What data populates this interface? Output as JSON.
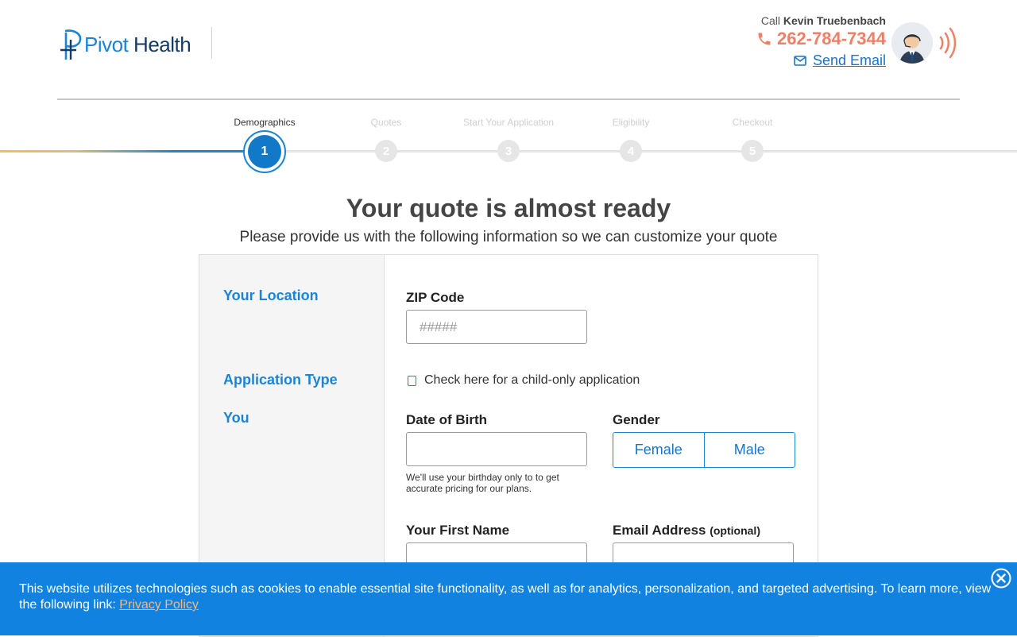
{
  "brand": {
    "name_part1": "Pivot",
    "name_part2": "Health"
  },
  "agent": {
    "call_prefix": "Call",
    "name": "Kevin Truebenbach",
    "phone": "262-784-7344",
    "email_link": "Send Email"
  },
  "steps": [
    {
      "num": "1",
      "label": "Demographics",
      "state": "active"
    },
    {
      "num": "2",
      "label": "Quotes",
      "state": "inactive"
    },
    {
      "num": "3",
      "label": "Start Your Application",
      "state": "inactive"
    },
    {
      "num": "4",
      "label": "Eligibility",
      "state": "inactive"
    },
    {
      "num": "5",
      "label": "Checkout",
      "state": "inactive"
    }
  ],
  "heading": {
    "title": "Your quote is almost ready",
    "subtitle": "Please provide us with the following information so we can customize your quote"
  },
  "form": {
    "sections": {
      "location": "Your Location",
      "application_type": "Application Type",
      "you": "You"
    },
    "zip": {
      "label": "ZIP Code",
      "placeholder": "#####",
      "value": ""
    },
    "child_only": {
      "label": "Check here for a child-only application",
      "checked": false
    },
    "dob": {
      "label": "Date of Birth",
      "value": "",
      "help": "We'll use your birthday only to to get accurate pricing for our plans."
    },
    "gender": {
      "label": "Gender",
      "options": [
        "Female",
        "Male"
      ]
    },
    "first_name": {
      "label": "Your First Name",
      "value": ""
    },
    "email": {
      "label": "Email Address",
      "optional_tag": "(optional)",
      "value": ""
    }
  },
  "cookie_banner": {
    "text": "This website utilizes technologies such as cookies to enable essential site functionality, as well as for analytics, personalization, and targeted advertising. To learn more, view the following link: ",
    "link": "Privacy Policy"
  },
  "colors": {
    "brand_blue": "#1a85d6",
    "phone_orange": "#ee8066",
    "cookie_bg": "#1282e0",
    "progress_gold": "#f0c24a"
  }
}
